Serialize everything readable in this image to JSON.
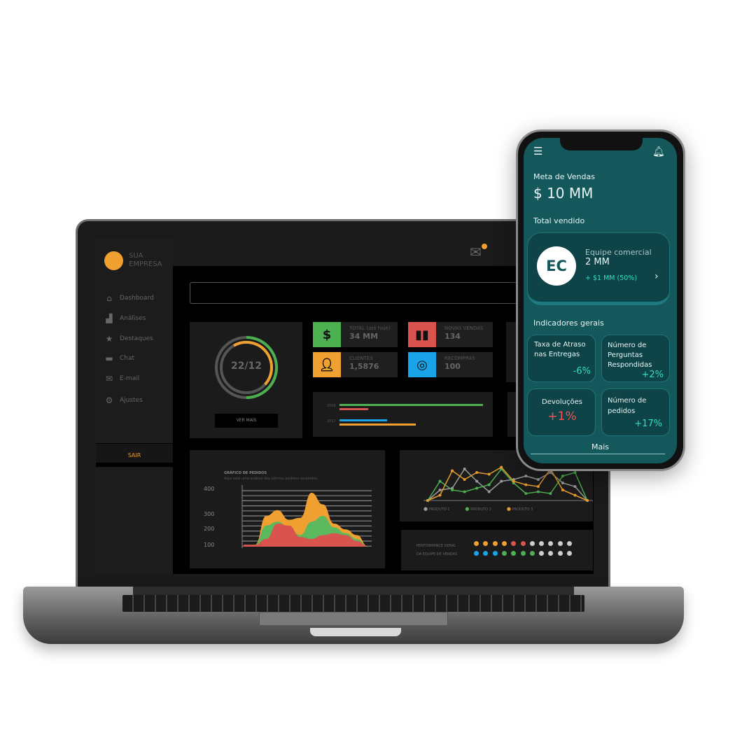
{
  "laptop": {
    "brand": {
      "line1": "SUA",
      "line2": "EMPRESA"
    },
    "nav": [
      {
        "label": "Dashboard",
        "icon": "home-icon"
      },
      {
        "label": "Análises",
        "icon": "bar-chart-icon"
      },
      {
        "label": "Destaques",
        "icon": "star-icon"
      },
      {
        "label": "Chat",
        "icon": "chat-icon"
      },
      {
        "label": "E-mail",
        "icon": "mail-icon"
      },
      {
        "label": "Ajustes",
        "icon": "gear-icon"
      }
    ],
    "logout": "SAIR",
    "donut": {
      "label": "22/12",
      "button": "VER MAIS",
      "outer_progress": 0.5,
      "inner_progress": 0.45
    },
    "kpis": [
      {
        "label": "TOTAL (até hoje)",
        "value": "34 MM",
        "color": "#4caf50",
        "icon": "dollar-icon"
      },
      {
        "label": "NOVAS VENDAS",
        "value": "134",
        "color": "#d9534f",
        "icon": "bar-chart-icon"
      },
      {
        "label": "CLIENTES",
        "value": "1,5876",
        "color": "#f0a030",
        "icon": "user-icon"
      },
      {
        "label": "RECOMPRAS",
        "value": "100",
        "color": "#1aa3e8",
        "icon": "target-icon"
      }
    ],
    "bars": {
      "rows": [
        {
          "label": "2018",
          "values": [
            {
              "v": 100,
              "c": "#4caf50"
            },
            {
              "v": 20,
              "c": "#d9534f"
            }
          ]
        },
        {
          "label": "2017",
          "values": [
            {
              "v": 33,
              "c": "#1aa3e8"
            },
            {
              "v": 53,
              "c": "#f0a030"
            }
          ]
        }
      ]
    },
    "area_chart": {
      "title": "GRÁFICO DE PEDIDOS",
      "subtitle": "Aqui está uma análise dos últimos pedidos recebidos",
      "yticks": [
        "400",
        "300",
        "200",
        "100"
      ],
      "series": [
        {
          "color": "#f0a030",
          "values": [
            5,
            5,
            80,
            95,
            70,
            75,
            140,
            110,
            60,
            45,
            30,
            0
          ]
        },
        {
          "color": "#5cb85c",
          "values": [
            5,
            5,
            55,
            65,
            50,
            30,
            65,
            80,
            50,
            35,
            20,
            0
          ]
        },
        {
          "color": "#d9534f",
          "values": [
            5,
            5,
            20,
            60,
            55,
            25,
            20,
            30,
            35,
            30,
            15,
            0
          ]
        }
      ]
    },
    "line_chart": {
      "series": [
        {
          "name": "PRODUTO 1",
          "color": "#9a9a9a",
          "values": [
            0,
            30,
            35,
            90,
            55,
            25,
            55,
            60,
            70,
            60,
            80,
            50,
            40,
            0
          ]
        },
        {
          "name": "PRODUTO 2",
          "color": "#4caf50",
          "values": [
            0,
            55,
            30,
            25,
            35,
            45,
            90,
            50,
            20,
            25,
            20,
            70,
            80,
            0
          ]
        },
        {
          "name": "PRODUTO 3",
          "color": "#e89b2c",
          "values": [
            0,
            15,
            85,
            60,
            80,
            75,
            95,
            55,
            45,
            40,
            90,
            30,
            15,
            0
          ]
        }
      ]
    },
    "performance": {
      "label1": "PERFORMANCE GERAL",
      "label2": "DA EQUIPE DE VENDAS",
      "row1": [
        "#f0a030",
        "#f0a030",
        "#f0a030",
        "#f0a030",
        "#d9534f",
        "#d9534f",
        "#ccc",
        "#ccc",
        "#ccc",
        "#ccc",
        "#ccc"
      ],
      "row2": [
        "#1aa3e8",
        "#1aa3e8",
        "#1aa3e8",
        "#4caf50",
        "#4caf50",
        "#4caf50",
        "#4caf50",
        "#ccc",
        "#ccc",
        "#ccc",
        "#ccc"
      ]
    }
  },
  "phone": {
    "goal_label": "Meta de Vendas",
    "goal_value": "$ 10 MM",
    "sold_label": "Total vendido",
    "team": {
      "initials": "EC",
      "name": "Equipe comercial",
      "value": "2 MM",
      "delta": "+ $1 MM (50%)"
    },
    "indicators_label": "Indicadores gerais",
    "indicators": [
      {
        "label": "Taxa de Atraso nas Entregas",
        "value": "-6%"
      },
      {
        "label": "Número de Perguntas Respondidas",
        "value": "+2%"
      },
      {
        "label": "Devoluções",
        "value": "+1%"
      },
      {
        "label": "Número de pedidos",
        "value": "+17%"
      }
    ],
    "more": "Mais",
    "colors": {
      "bg": "#14585c",
      "accent": "#2fe0c4",
      "negative": "#ff4d4d"
    }
  }
}
